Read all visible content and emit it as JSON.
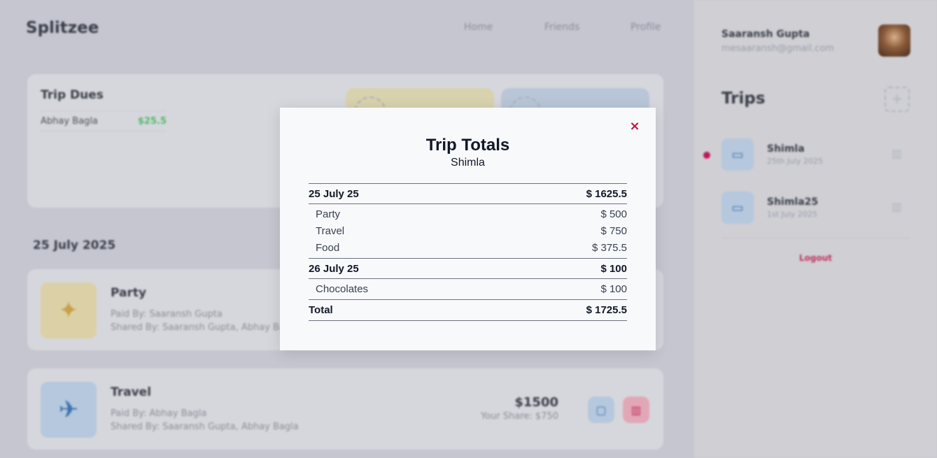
{
  "app": {
    "brand": "Splitzee",
    "nav": [
      "Home",
      "Friends",
      "Profile"
    ]
  },
  "dues": {
    "title": "Trip Dues",
    "entries": [
      {
        "name": "Abhay Bagla",
        "amount": "$25.5"
      }
    ]
  },
  "date_heading": "25 July 2025",
  "expenses": [
    {
      "name": "Party",
      "paid_by": "Paid By: Saaransh Gupta",
      "shared_by": "Shared By: Saaransh Gupta, Abhay Bagla",
      "icon": "party-popper-icon"
    },
    {
      "name": "Travel",
      "paid_by": "Paid By: Abhay Bagla",
      "shared_by": "Shared By: Saaransh Gupta, Abhay Bagla",
      "amount": "$1500",
      "your_share": "Your Share: $750",
      "icon": "airplane-icon"
    }
  ],
  "user": {
    "name": "Saaransh Gupta",
    "email": "mesaaransh@gmail.com"
  },
  "trips": {
    "title": "Trips",
    "items": [
      {
        "name": "Shimla",
        "date": "25th July 2025",
        "active": true
      },
      {
        "name": "Shimla25",
        "date": "1st July 2025",
        "active": false
      }
    ],
    "logout": "Logout"
  },
  "modal": {
    "close_icon": "×",
    "title": "Trip Totals",
    "subtitle": "Shimla",
    "groups": [
      {
        "date": "25 July 25",
        "total": "$ 1625.5",
        "items": [
          {
            "label": "Party",
            "amount": "$ 500"
          },
          {
            "label": "Travel",
            "amount": "$ 750"
          },
          {
            "label": "Food",
            "amount": "$ 375.5"
          }
        ]
      },
      {
        "date": "26 July 25",
        "total": "$ 100",
        "items": [
          {
            "label": "Chocolates",
            "amount": "$ 100"
          }
        ]
      }
    ],
    "total_label": "Total",
    "total_value": "$ 1725.5"
  },
  "colors": {
    "accent_red": "#c2133f",
    "due_green": "#52b86a",
    "active_dot": "#c2185b"
  }
}
